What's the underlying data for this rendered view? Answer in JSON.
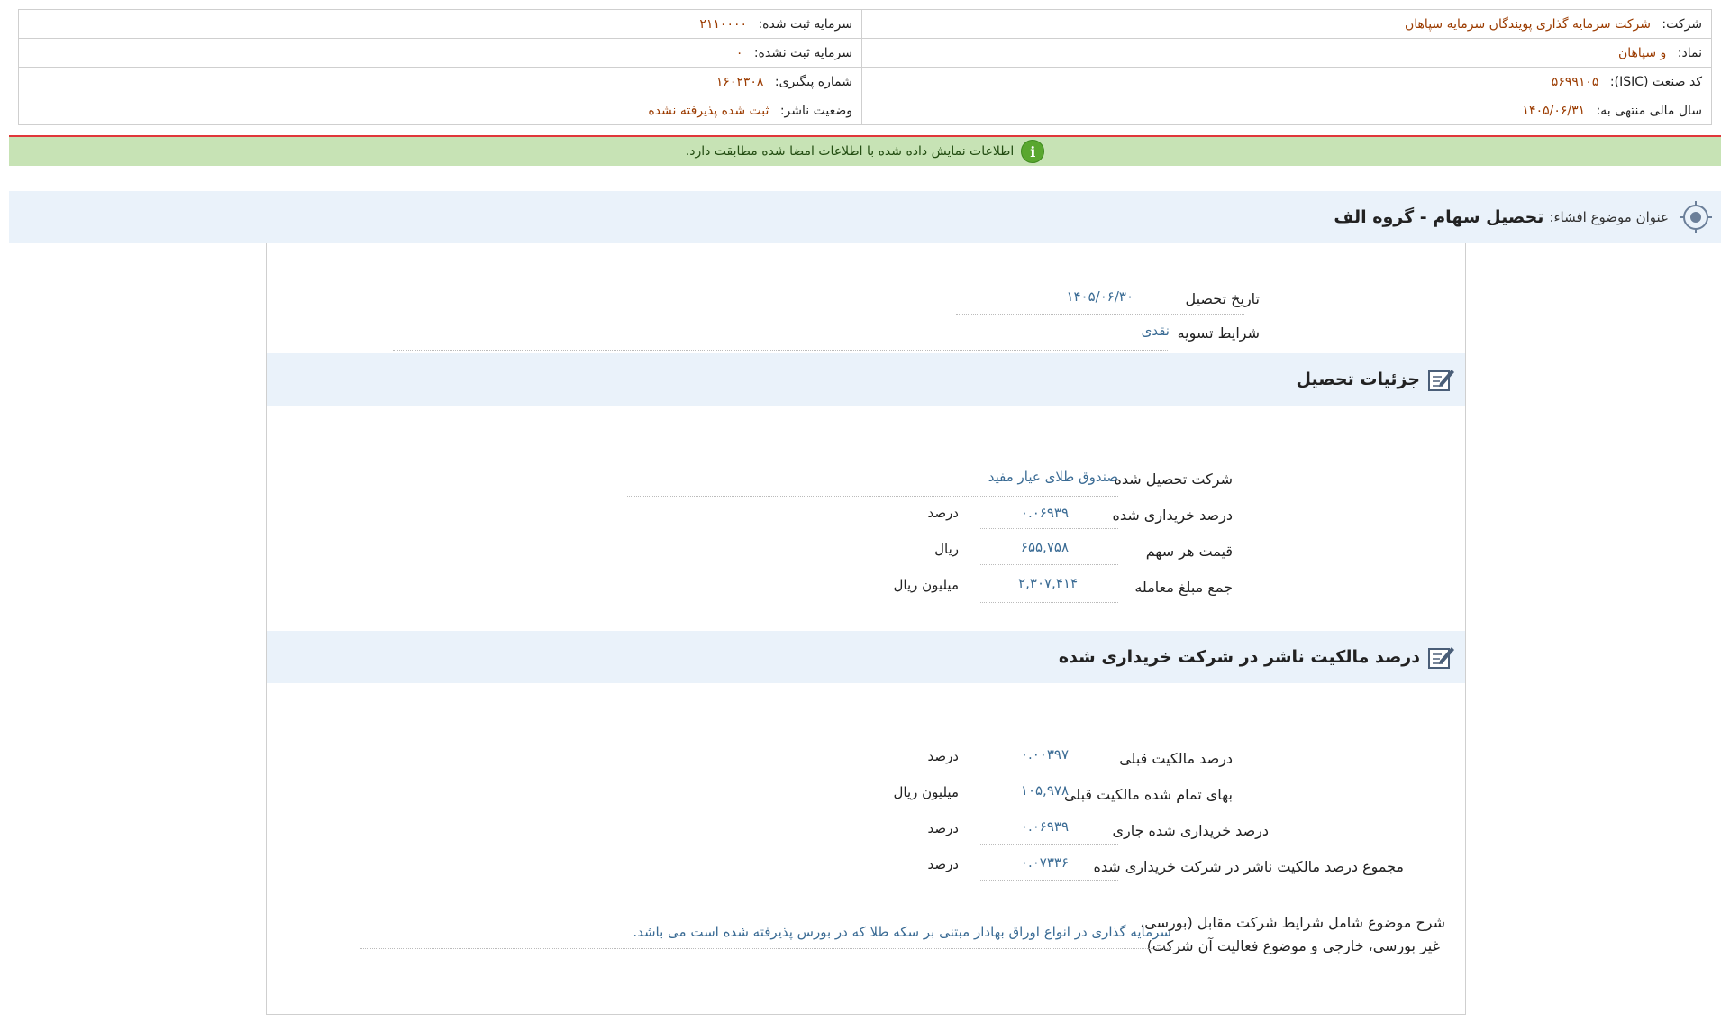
{
  "header": {
    "company_label": "شرکت:",
    "company_value": "شرکت سرمایه گذاری پویندگان سرمایه سپاهان",
    "capital_registered_label": "سرمایه ثبت شده:",
    "capital_registered_value": "۲۱۱۰۰۰۰",
    "symbol_label": "نماد:",
    "symbol_value": "و سپاهان",
    "capital_unregistered_label": "سرمایه ثبت نشده:",
    "capital_unregistered_value": "۰",
    "isic_label": "کد صنعت (ISIC):",
    "isic_value": "۵۶۹۹۱۰۵",
    "tracking_label": "شماره پیگیری:",
    "tracking_value": "۱۶۰۲۳۰۸",
    "fiscal_year_label": "سال مالی منتهی به:",
    "fiscal_year_value": "۱۴۰۵/۰۶/۳۱",
    "publisher_status_label": "وضعیت ناشر:",
    "publisher_status_value": "ثبت شده پذیرفته نشده"
  },
  "banner": {
    "text": "اطلاعات نمایش داده شده با اطلاعات امضا شده مطابقت دارد.",
    "icon": "info-icon",
    "color": "#c7e3b5"
  },
  "topic": {
    "label": "عنوان موضوع افشاء:",
    "title": "تحصیل سهام - گروه الف"
  },
  "general": {
    "acquisition_date_label": "تاریخ تحصیل",
    "acquisition_date_value": "۱۴۰۵/۰۶/۳۰",
    "settlement_label": "شرایط تسویه",
    "settlement_value": "نقدی"
  },
  "details": {
    "title": "جزئیات تحصیل",
    "acquired_company_label": "شرکت تحصیل شده",
    "acquired_company_value": "صندوق طلای عیار مفید",
    "rows": [
      {
        "label": "درصد خریداری شده",
        "value": "۰.۰۶۹۳۹",
        "unit": "درصد"
      },
      {
        "label": "قیمت هر سهم",
        "value": "۶۵۵,۷۵۸",
        "unit": "ریال"
      },
      {
        "label": "جمع مبلغ معامله",
        "value": "۲,۳۰۷,۴۱۴",
        "unit": "میلیون ریال"
      }
    ]
  },
  "ownership": {
    "title": "درصد مالکیت ناشر در شرکت خریداری شده",
    "rows": [
      {
        "label": "درصد مالکیت قبلی",
        "value": "۰.۰۰۳۹۷",
        "unit": "درصد"
      },
      {
        "label": "بهای تمام شده مالکیت قبلی",
        "value": "۱۰۵,۹۷۸",
        "unit": "میلیون ریال"
      },
      {
        "label": "درصد خریداری شده جاری",
        "value": "۰.۰۶۹۳۹",
        "unit": "درصد"
      },
      {
        "label": "مجموع درصد مالکیت ناشر در شرکت خریداری شده",
        "value": "۰.۰۷۳۳۶",
        "unit": "درصد"
      }
    ],
    "description_label_line1": "شرح موضوع شامل شرایط شرکت مقابل (بورسی،",
    "description_label_line2": "غیر بورسی، خارجی و موضوع فعالیت آن شرکت)",
    "description_value": "سرمایه گذاری در انواع اوراق بهادار مبتنی بر سکه طلا که در بورس پذیرفته شده است می باشد."
  }
}
